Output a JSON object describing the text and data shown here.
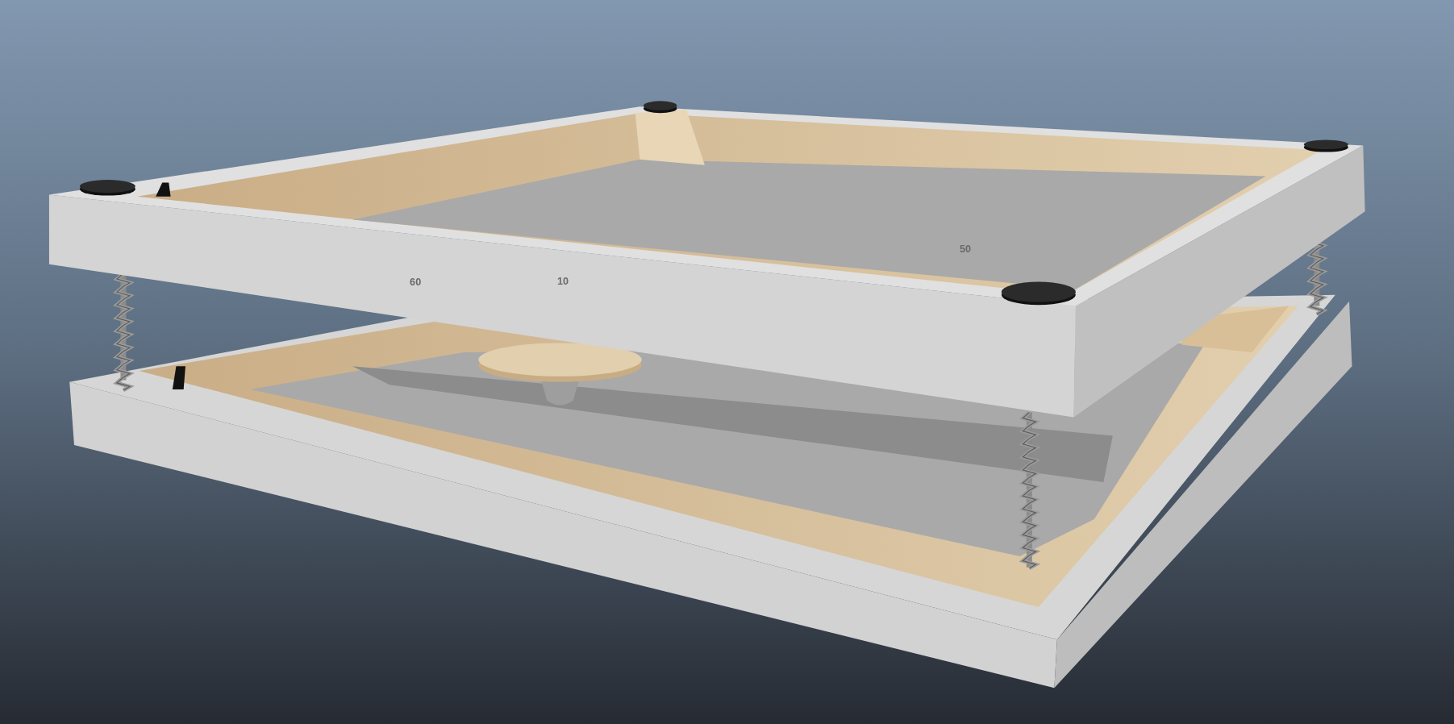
{
  "viewport": {
    "dimension_labels": [
      {
        "text": "60"
      },
      {
        "text": "10"
      },
      {
        "text": "50"
      }
    ]
  }
}
